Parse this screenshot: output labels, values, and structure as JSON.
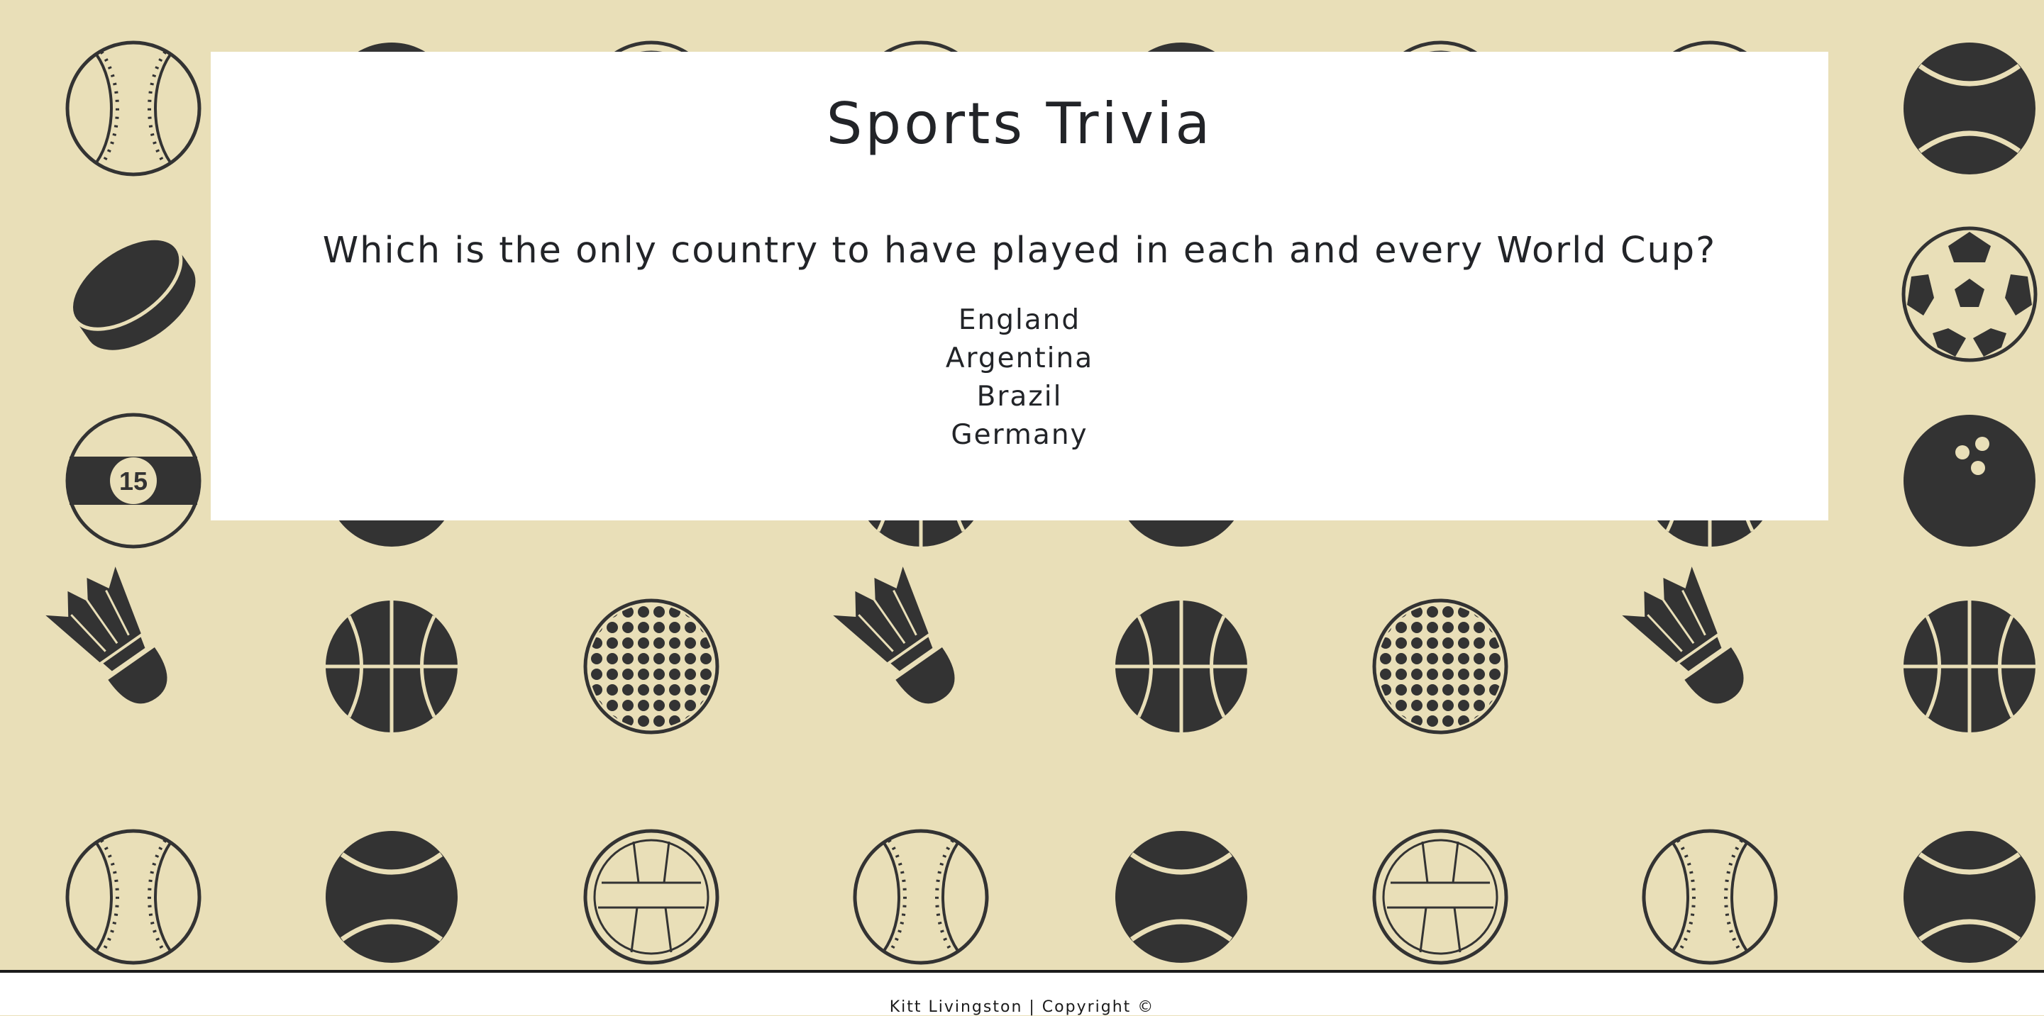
{
  "page": {
    "title": "Sports Trivia"
  },
  "question": {
    "text": "Which is the only country to have played in each and every World Cup?"
  },
  "answers": [
    "England",
    "Argentina",
    "Brazil",
    "Germany"
  ],
  "footer": {
    "text": "Kitt Livingston | Copyright ©"
  },
  "background": {
    "colors": {
      "tan": "#e9dfb8",
      "icon": "#333333",
      "card": "#ffffff"
    },
    "icons": [
      "baseball-icon",
      "tennis-ball-icon",
      "volleyball-icon",
      "hockey-puck-icon",
      "soccer-ball-icon",
      "billiard-ball-icon",
      "bowling-ball-icon",
      "shuttlecock-icon",
      "basketball-icon",
      "golf-ball-icon"
    ],
    "billiard_number": "15"
  }
}
